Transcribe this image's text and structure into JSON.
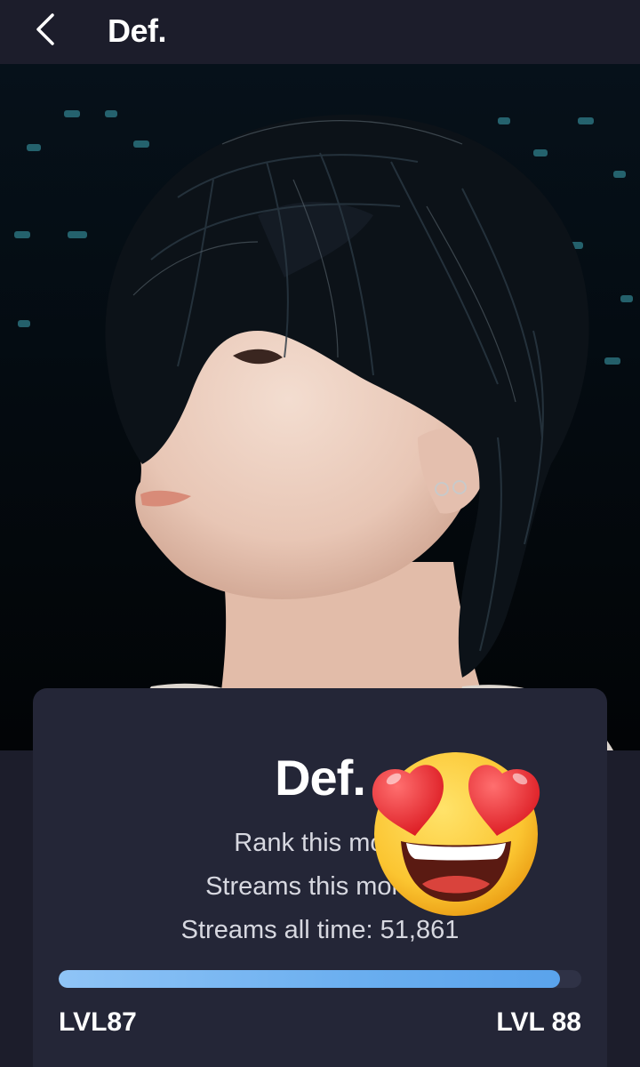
{
  "header": {
    "title": "Def."
  },
  "hero": {
    "image": "artist-portrait-photo"
  },
  "card": {
    "artist_name": "Def.",
    "rank_text": "Rank this mont",
    "streams_month_text": "Streams this month:",
    "streams_all_text": "Streams all time: 51,861"
  },
  "level": {
    "current_label": "LVL87",
    "next_label": "LVL 88",
    "progress_percent": 96
  },
  "sticker": {
    "icon": "heart-eyes-emoji"
  },
  "colors": {
    "background": "#1c1d2b",
    "card": "#242637",
    "progress": "#6aaeef"
  }
}
